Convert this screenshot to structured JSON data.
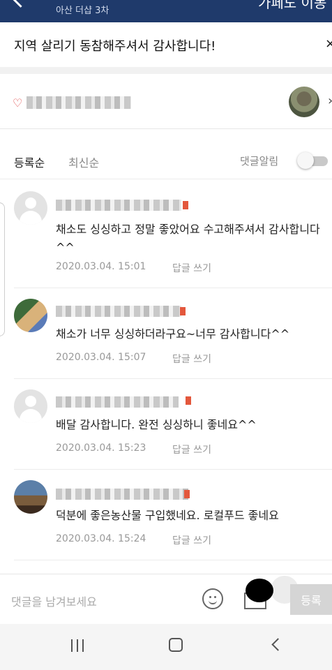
{
  "header": {
    "subtitle": "아산 더샵 3차",
    "title_partial": "가페도 이동"
  },
  "notice": {
    "text": "지역 살리기 동참해주셔서 감사합니다!",
    "close_glyph": "×"
  },
  "sort": {
    "by_registration": "등록순",
    "by_latest": "최신순",
    "notification_label": "댓글알림",
    "notification_on": false
  },
  "comments": [
    {
      "text": "채소도 싱싱하고 정말 좋았어요 수고해주셔서 감사합니다 ^^",
      "date": "2020.03.04. 15:01",
      "reply": "답글 쓰기"
    },
    {
      "text": "채소가 너무 싱싱하더라구요~너무 감사합니다^^",
      "date": "2020.03.04. 15:07",
      "reply": "답글 쓰기"
    },
    {
      "text": "배달 감사합니다. 완전 싱싱하니 좋네요^^",
      "date": "2020.03.04. 15:23",
      "reply": "답글 쓰기"
    },
    {
      "text": "덕분에 좋은농산물 구입했네요. 로컬푸드 좋네요",
      "date": "2020.03.04. 15:24",
      "reply": "답글 쓰기"
    }
  ],
  "composer": {
    "placeholder": "댓글을 남겨보세요",
    "submit": "등록"
  },
  "icons": {
    "back": "back-arrow-icon",
    "emoji": "emoji-icon",
    "image": "image-icon"
  },
  "colors": {
    "header_bg": "#1f3a6b",
    "accent_red": "#e3573c"
  }
}
